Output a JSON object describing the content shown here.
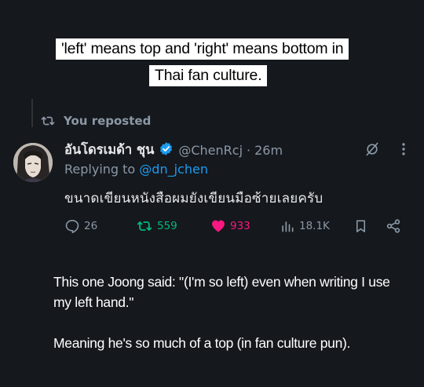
{
  "caption": {
    "line1": "'left' means top and 'right' means bottom in",
    "line2": "Thai fan culture."
  },
  "repost_banner": {
    "text": "You reposted",
    "icon": "repost-icon"
  },
  "tweet": {
    "display_name": "อันโดรเมด้า ชุน",
    "verified": true,
    "handle": "@ChenRcj",
    "separator": "·",
    "time": "26m",
    "replying_prefix": "Replying to",
    "replying_to": "@dn_jchen",
    "text": "ขนาดเขียนหนังสือผมยังเขียนมือซ้ายเลยครับ",
    "icons": {
      "avatar": "avatar-image",
      "verified": "verified-badge-icon",
      "grok": "grok-icon",
      "more": "more-dots-icon"
    },
    "actions": {
      "replies": "26",
      "reposts": "559",
      "likes": "933",
      "views": "18.1K",
      "icons": [
        "reply-icon",
        "repost-icon",
        "heart-icon",
        "views-icon",
        "bookmark-icon",
        "share-icon"
      ]
    }
  },
  "explanation": {
    "paragraph1": "This one Joong said: \"(I'm so left) even when writing I use my left hand.\"",
    "paragraph2": "Meaning he's so much of a top (in fan culture pun)."
  },
  "colors": {
    "background": "#15181d",
    "muted": "#8b98a5",
    "link": "#1d9bf0",
    "repost_green": "#00ba7c",
    "like_pink": "#f91880",
    "verified_blue": "#1d9bf0"
  }
}
